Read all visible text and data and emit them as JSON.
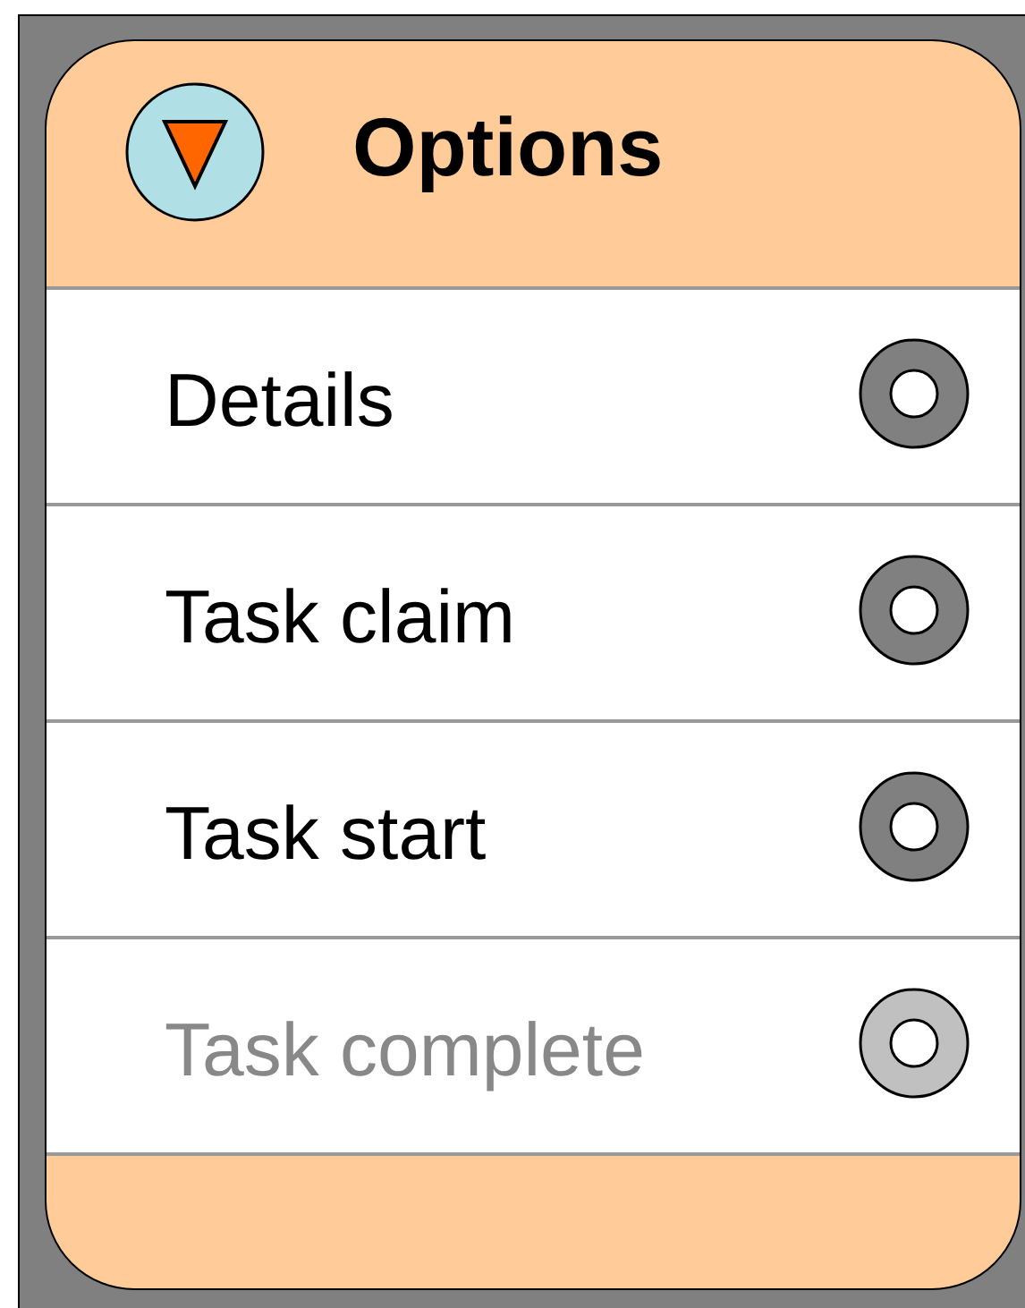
{
  "title": "Options",
  "items": [
    {
      "label": "Details",
      "disabled": false
    },
    {
      "label": "Task claim",
      "disabled": false
    },
    {
      "label": "Task start",
      "disabled": false
    },
    {
      "label": "Task complete",
      "disabled": true
    }
  ]
}
